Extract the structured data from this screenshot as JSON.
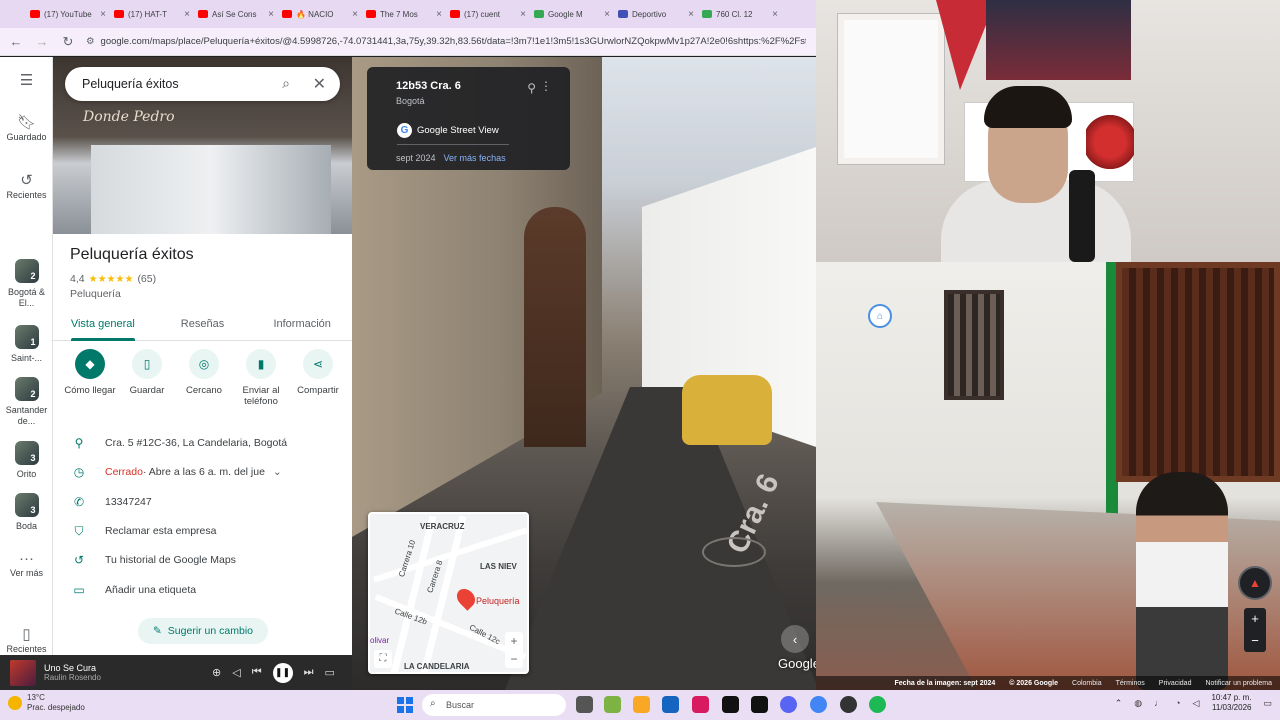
{
  "browser": {
    "tabs": [
      {
        "label": "(17) YouTube",
        "color": "#ff0000"
      },
      {
        "label": "(17) HAT-T",
        "color": "#ff0000"
      },
      {
        "label": "Así Se Cons",
        "color": "#ff0000"
      },
      {
        "label": "🔥 NACIO",
        "color": "#ff0000"
      },
      {
        "label": "The 7 Mos",
        "color": "#ff0000"
      },
      {
        "label": "(17) cuent",
        "color": "#ff0000"
      },
      {
        "label": "Google M",
        "color": "#34a853"
      },
      {
        "label": "Deportivo",
        "color": "#3f51b5"
      },
      {
        "label": "760 Cl. 12",
        "color": "#34a853"
      }
    ],
    "url": "google.com/maps/place/Peluquería+éxitos/@4.5998726,-74.0731441,3a,75y,39.32h,83.56t/data=!3m7!1e1!3m5!1s3GUrwlorNZQokpwMv1p27A!2e0!6shttps:%2F%2Fstreetvie"
  },
  "rail": {
    "saved": "Guardado",
    "recents": "Recientes",
    "items": [
      {
        "label": "Bogotá & El...",
        "badge": "2"
      },
      {
        "label": "Saint-...",
        "badge": "1"
      },
      {
        "label": "Santander de...",
        "badge": "2"
      },
      {
        "label": "Orito",
        "badge": "3"
      },
      {
        "label": "Boda",
        "badge": "3"
      }
    ],
    "more": "Ver más",
    "recent_bottom": "Recientes"
  },
  "panel": {
    "search_value": "Peluquería éxitos",
    "photo_sign": "Donde Pedro",
    "title": "Peluquería éxitos",
    "rating": "4,4",
    "stars": "★★★★★",
    "reviews": "(65)",
    "category": "Peluquería",
    "tabs": [
      "Vista general",
      "Reseñas",
      "Información"
    ],
    "actions": [
      "Cómo llegar",
      "Guardar",
      "Cercano",
      "Enviar al teléfono",
      "Compartir"
    ],
    "address": "Cra. 5 #12C-36, La Candelaria, Bogotá",
    "hours_status": "Cerrado",
    "hours_detail": " · Abre a las 6 a. m. del jue",
    "phone": "13347247",
    "claim": "Reclamar esta empresa",
    "history": "Tu historial de Google Maps",
    "label": "Añadir una etiqueta",
    "suggest": "Sugerir un cambio"
  },
  "streetview": {
    "address": "12b53 Cra. 6",
    "city": "Bogotá",
    "source": "Google Street View",
    "date": "sept 2024",
    "more_dates": "Ver más fechas",
    "road_paint": "Cra. 6",
    "logo": "Google Maps",
    "minimap": {
      "labels": [
        "VERACRUZ",
        "LAS NIEV",
        "Carrera 10",
        "Carrera 8",
        "Calle 12b",
        "Calle 12c",
        "LA CANDELARIA",
        "olivar"
      ],
      "place": "Peluquería"
    }
  },
  "sv2_footer": {
    "date": "Fecha de la imagen: sept 2024",
    "copyright": "© 2026 Google",
    "country": "Colombia",
    "terms": "Términos",
    "privacy": "Privacidad",
    "report": "Notificar un problema"
  },
  "player": {
    "song": "Uno Se Cura",
    "artist": "Raulin Rosendo"
  },
  "taskbar": {
    "temp": "13°C",
    "weather": "Prac. despejado",
    "search": "Buscar",
    "time": "10:47 p. m.",
    "date": "11/03/2026"
  }
}
